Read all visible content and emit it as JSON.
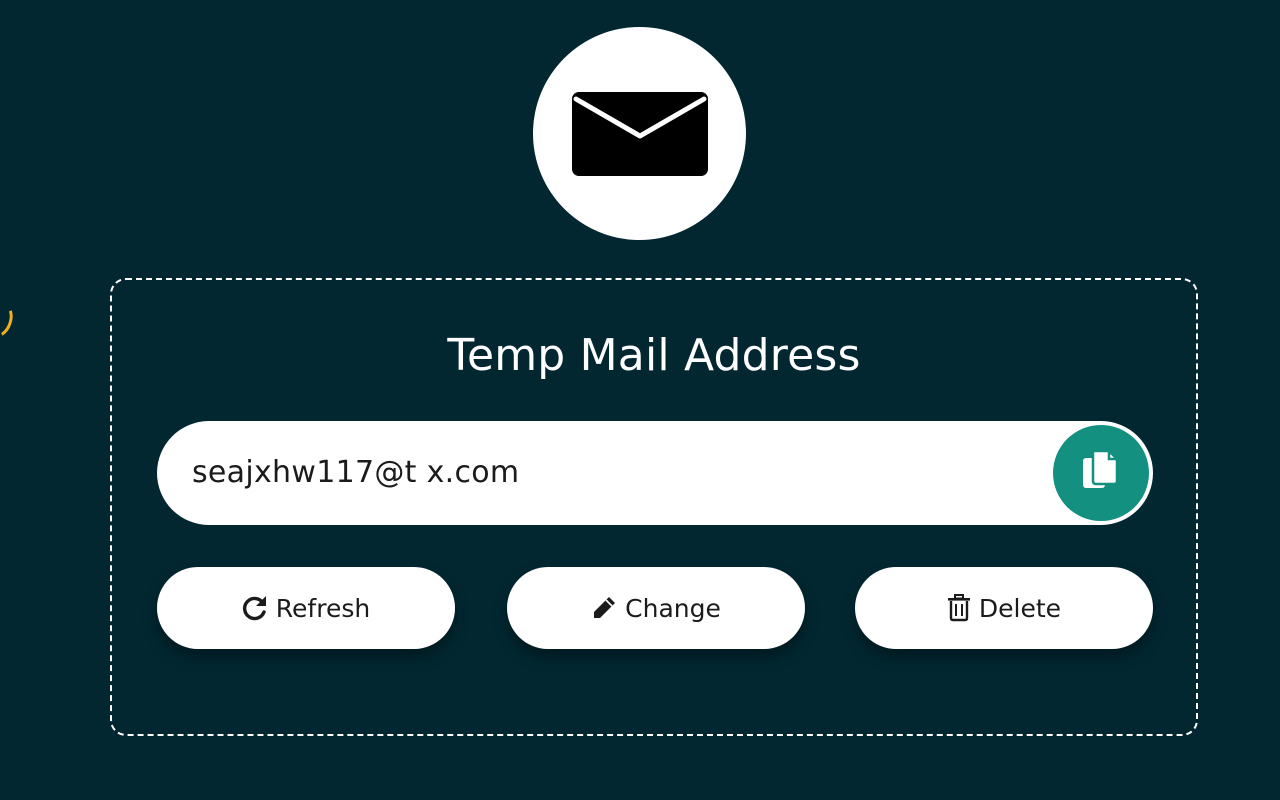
{
  "icons": {
    "mail": "envelope-icon",
    "copy": "copy-icon",
    "refresh": "refresh-icon",
    "change": "pencil-icon",
    "delete": "trash-icon"
  },
  "colors": {
    "background": "#022731",
    "accent": "#13907f",
    "panel_border": "#ffffff"
  },
  "panel": {
    "title": "Temp Mail Address"
  },
  "email": {
    "value": "seajxhw117@t      x.com"
  },
  "actions": {
    "refresh_label": "Refresh",
    "change_label": "Change",
    "delete_label": "Delete"
  }
}
